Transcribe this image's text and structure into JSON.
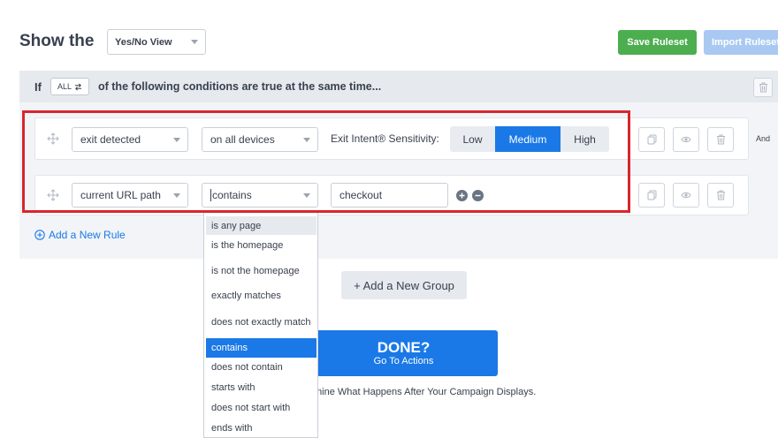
{
  "header": {
    "title": "Show the",
    "view_select": "Yes/No View",
    "save_label": "Save Ruleset",
    "import_label": "Import Ruleset"
  },
  "group": {
    "if_label": "If",
    "all_label": "ALL",
    "all_icon": "swap-icon",
    "conditions_text": "of the following conditions are true at the same time...",
    "and_label": "And"
  },
  "rules": [
    {
      "condition": "exit detected",
      "operator": "on all devices",
      "sensitivity_label": "Exit Intent® Sensitivity:",
      "sensitivity_options": [
        "Low",
        "Medium",
        "High"
      ],
      "sensitivity_selected": "Medium"
    },
    {
      "condition": "current URL path",
      "operator": "contains",
      "value": "checkout"
    }
  ],
  "add_rule_label": "Add a New Rule",
  "add_group_label": "+ Add a New Group",
  "done": {
    "title": "DONE?",
    "subtitle": "Go To Actions"
  },
  "footer_text": "mine What Happens After Your Campaign Displays.",
  "dropdown": {
    "options": [
      "is any page",
      "is the homepage",
      "is not the homepage",
      "exactly matches",
      "does not exactly match",
      "contains",
      "does not contain",
      "starts with",
      "does not start with",
      "ends with"
    ],
    "hovered": "is any page",
    "selected": "contains"
  },
  "colors": {
    "primary": "#1a79e6",
    "save": "#4cae4f",
    "highlight": "#d8262c"
  }
}
